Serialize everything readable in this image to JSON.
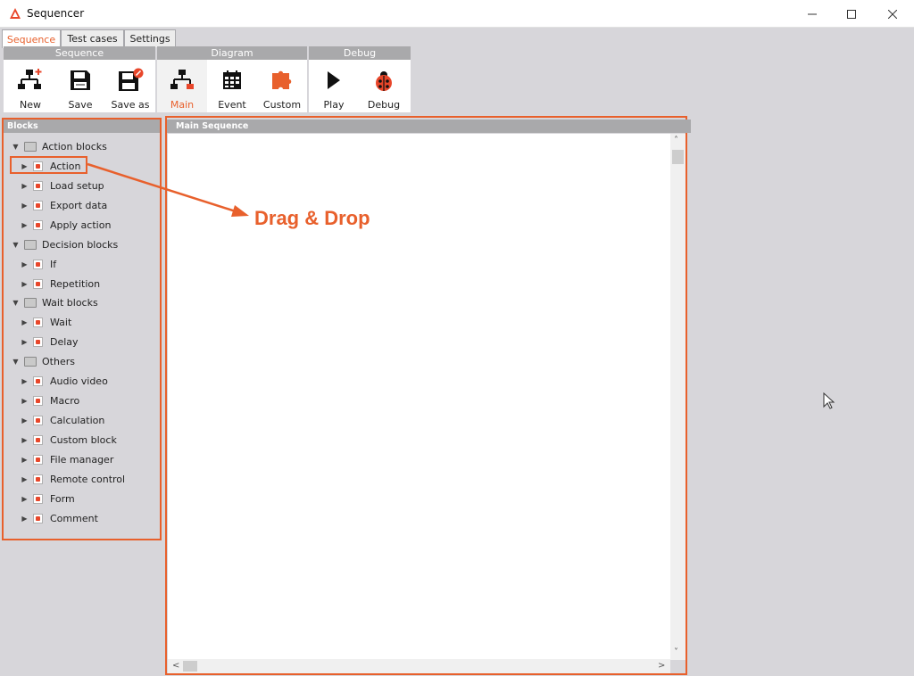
{
  "window": {
    "title": "Sequencer"
  },
  "tabs": [
    {
      "label": "Sequence",
      "active": true
    },
    {
      "label": "Test cases",
      "active": false
    },
    {
      "label": "Settings",
      "active": false
    }
  ],
  "ribbon": {
    "groups": [
      {
        "title": "Sequence",
        "buttons": [
          {
            "label": "New",
            "icon": "new-sequence-icon"
          },
          {
            "label": "Save",
            "icon": "save-icon"
          },
          {
            "label": "Save as",
            "icon": "save-as-icon"
          }
        ]
      },
      {
        "title": "Diagram",
        "buttons": [
          {
            "label": "Main",
            "icon": "flowchart-icon",
            "active": true
          },
          {
            "label": "Event",
            "icon": "calendar-icon"
          },
          {
            "label": "Custom",
            "icon": "puzzle-icon"
          }
        ]
      },
      {
        "title": "Debug",
        "buttons": [
          {
            "label": "Play",
            "icon": "play-icon"
          },
          {
            "label": "Debug",
            "icon": "ladybug-icon"
          }
        ]
      }
    ]
  },
  "blocks_panel": {
    "title": "Blocks",
    "categories": [
      {
        "label": "Action blocks",
        "items": [
          "Action",
          "Load setup",
          "Export data",
          "Apply action"
        ]
      },
      {
        "label": "Decision blocks",
        "items": [
          "If",
          "Repetition"
        ]
      },
      {
        "label": "Wait blocks",
        "items": [
          "Wait",
          "Delay"
        ]
      },
      {
        "label": "Others",
        "items": [
          "Audio video",
          "Macro",
          "Calculation",
          "Custom block",
          "File manager",
          "Remote control",
          "Form",
          "Comment"
        ]
      }
    ]
  },
  "main_panel": {
    "title": "Main Sequence"
  },
  "annotation": {
    "text": "Drag & Drop"
  },
  "colors": {
    "accent": "#e8602c",
    "header_gray": "#a9a9ab",
    "background": "#d7d6da"
  }
}
